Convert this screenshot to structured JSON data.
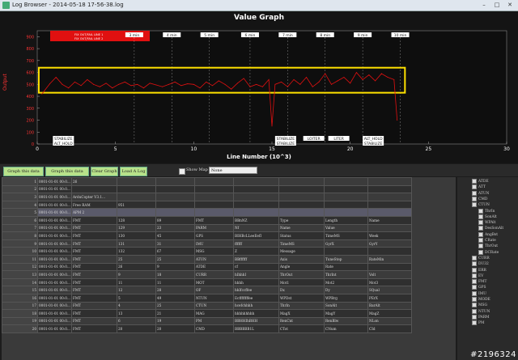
{
  "window": {
    "title": "Log Browser - 2014-05-18 17-56-38.log"
  },
  "graph": {
    "title": "Value Graph",
    "xlabel": "Line Number (10^3)",
    "ylabel": "Output",
    "legend": [
      "FIX OUT/FAIL LINE 1",
      "FIX OUT/FAIL LINE 2"
    ],
    "yticks": [
      "900",
      "800",
      "700",
      "600",
      "500",
      "400",
      "300",
      "200",
      "100",
      "0"
    ],
    "xticks": [
      "0",
      "5",
      "10",
      "15",
      "20",
      "25",
      "30"
    ],
    "time_marks": [
      "3 min",
      "4 min",
      "5 min",
      "6 min",
      "7 min",
      "8 min",
      "9 min",
      "10 min"
    ],
    "mode_labels_top": [
      "STABILIZE",
      "STABILIZE",
      "LOITER",
      "LITER",
      "ALT_HOLD"
    ],
    "mode_labels_bottom": [
      "ALT_HOLD",
      "STABILIZE",
      "STABILIZE"
    ],
    "highlight_color": "#ffe100",
    "series_color": "#e01010"
  },
  "chart_data": {
    "type": "line",
    "title": "Value Graph",
    "xlabel": "Line Number (10^3)",
    "ylabel": "Output",
    "xlim": [
      0,
      30
    ],
    "ylim": [
      0,
      950
    ],
    "x": [
      0.3,
      0.8,
      1.2,
      1.6,
      2.0,
      2.4,
      2.8,
      3.2,
      3.6,
      4.0,
      4.4,
      4.8,
      5.2,
      5.6,
      6.0,
      6.4,
      6.8,
      7.2,
      7.6,
      8.0,
      8.4,
      8.8,
      9.2,
      9.6,
      10.0,
      10.4,
      10.8,
      11.2,
      11.6,
      12.0,
      12.4,
      12.8,
      13.2,
      13.6,
      14.0,
      14.4,
      14.8,
      15.0,
      15.2,
      15.6,
      16.0,
      16.4,
      16.8,
      17.2,
      17.6,
      18.0,
      18.4,
      18.8,
      19.2,
      19.6,
      20.0,
      20.4,
      20.8,
      21.2,
      21.6,
      22.0,
      22.4,
      22.8,
      23.0
    ],
    "series": [
      {
        "values": [
          420,
          505,
          560,
          500,
          470,
          520,
          490,
          540,
          500,
          480,
          510,
          470,
          500,
          520,
          490,
          500,
          470,
          510,
          495,
          480,
          500,
          520,
          490,
          505,
          500,
          470,
          520,
          490,
          530,
          500,
          460,
          510,
          550,
          480,
          500,
          480,
          540,
          150,
          500,
          520,
          480,
          540,
          500,
          560,
          480,
          520,
          590,
          500,
          530,
          560,
          510,
          600,
          540,
          580,
          530,
          590,
          560,
          540,
          200
        ]
      }
    ]
  },
  "toolbar": {
    "btn1": "Graph this data Left",
    "btn2": "Graph this data Right",
    "btn3": "Clear Graph",
    "btn4": "Load A Log",
    "show_map": "Show Map",
    "select_value": "None"
  },
  "table": {
    "rows": [
      [
        "1",
        "0001-01-01 00:0...",
        "26",
        "",
        "",
        "",
        "",
        "",
        "",
        ""
      ],
      [
        "2",
        "0001-01-01 00:0...",
        "",
        "",
        "",
        "",
        "",
        "",
        "",
        ""
      ],
      [
        "3",
        "0001-01-01 00:0...",
        "ArduCopter V3.1...",
        "",
        "",
        "",
        "",
        "",
        "",
        ""
      ],
      [
        "4",
        "0001-01-01 00:0...",
        "Free RAM",
        "951",
        "",
        "",
        "",
        "",
        "",
        ""
      ],
      [
        "5",
        "0001-01-01 00:0...",
        "APM 2",
        "",
        "",
        "",
        "",
        "",
        "",
        ""
      ],
      [
        "6",
        "0001-01-01 00:0...",
        "FMT",
        "128",
        "89",
        "FMT",
        "BBnNZ",
        "Type",
        "Length",
        "Name"
      ],
      [
        "7",
        "0001-01-01 00:0...",
        "FMT",
        "129",
        "23",
        "PARM",
        "Nf",
        "Name",
        "Value",
        ""
      ],
      [
        "8",
        "0001-01-01 00:0...",
        "FMT",
        "130",
        "45",
        "GPS",
        "BIHBcLLeeEefI",
        "Status",
        "TimeMS",
        "Week"
      ],
      [
        "9",
        "0001-01-01 00:0...",
        "FMT",
        "131",
        "31",
        "IMU",
        "ffffff",
        "TimeMS",
        "GyrX",
        "GyrY"
      ],
      [
        "10",
        "0001-01-01 00:0...",
        "FMT",
        "132",
        "67",
        "MSG",
        "Z",
        "Message",
        "",
        ""
      ],
      [
        "11",
        "0001-01-01 00:0...",
        "FMT",
        "25",
        "25",
        "ATUN",
        "BBffffff",
        "Axis",
        "TuneStep",
        "RateMin"
      ],
      [
        "12",
        "0001-01-01 00:0...",
        "FMT",
        "26",
        "9",
        "ATDE",
        "cf",
        "Angle",
        "Rate",
        ""
      ],
      [
        "13",
        "0001-01-01 00:0...",
        "FMT",
        "9",
        "18",
        "CURR",
        "hIhhhI",
        "ThrOut",
        "ThrInt",
        "Volt"
      ],
      [
        "14",
        "0001-01-01 00:0...",
        "FMT",
        "11",
        "11",
        "MOT",
        "hhhh",
        "Mot1",
        "Mot2",
        "Mot3"
      ],
      [
        "15",
        "0001-01-01 00:0...",
        "FMT",
        "12",
        "28",
        "OF",
        "hhIfccffee",
        "Dx",
        "Dy",
        "SQual"
      ],
      [
        "16",
        "0001-01-01 00:0...",
        "FMT",
        "5",
        "49",
        "NTUN",
        "Ecffffffffee",
        "WPDst",
        "WPBrg",
        "PErX"
      ],
      [
        "17",
        "0001-01-01 00:0...",
        "FMT",
        "4",
        "25",
        "CTUN",
        "hcefchhhh",
        "ThrIn",
        "SonAlt",
        "BarAlt"
      ],
      [
        "18",
        "0001-01-01 00:0...",
        "FMT",
        "13",
        "21",
        "MAG",
        "hhhhhhhhh",
        "MagX",
        "MagY",
        "MagZ"
      ],
      [
        "19",
        "0001-01-01 00:0...",
        "FMT",
        "6",
        "19",
        "PM",
        "BBHHIhBHH",
        "RenCnt",
        "RenBlw",
        "NLon"
      ],
      [
        "20",
        "0001-01-01 00:0...",
        "FMT",
        "20",
        "20",
        "CMD",
        "BBBBBB1L",
        "CTot",
        "CNum",
        "CId"
      ]
    ]
  },
  "tree": {
    "items": [
      "ATDE",
      "ATT",
      "ATUN",
      "CMD",
      "CTUN",
      "ThrIn",
      "SonAlt",
      "WPAlt",
      "DesSonAlt",
      "AngBst",
      "CRate",
      "ThrOut",
      "DCRate",
      "CURR",
      "DU32",
      "ERR",
      "EV",
      "FMT",
      "GPS",
      "IMU",
      "MODE",
      "MSG",
      "NTUN",
      "PARM",
      "PM"
    ]
  },
  "watermark": "#2196324"
}
